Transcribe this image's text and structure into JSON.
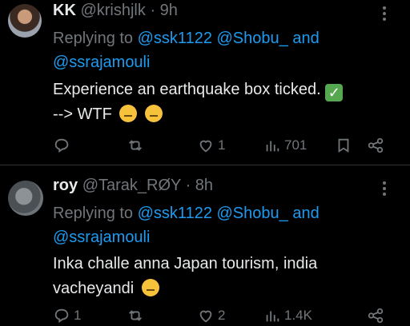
{
  "tweets": [
    {
      "name": "KK",
      "handle": "@krishjlk",
      "sep": "·",
      "time": "9h",
      "replying_label": "Replying to",
      "mentions": [
        "@ssk1122",
        "@Shobu_",
        "@ssrajamouli"
      ],
      "and_word": "and",
      "text_line1": "Experience an earthquake box ticked.",
      "text_line2": "--> WTF",
      "actions": {
        "likes": "1",
        "views": "701"
      }
    },
    {
      "name": "roy",
      "handle": "@Tarak_RØY",
      "sep": "·",
      "time": "8h",
      "replying_label": "Replying to",
      "mentions": [
        "@ssk1122",
        "@Shobu_",
        "@ssrajamouli"
      ],
      "and_word": "and",
      "text_line1": "Inka challe anna Japan tourism, india",
      "text_line2": "vacheyandi",
      "actions": {
        "replies": "1",
        "likes": "2",
        "views": "1.4K"
      }
    }
  ],
  "icons": {
    "reply": "reply-icon",
    "retweet": "retweet-icon",
    "like": "heart-icon",
    "views": "views-icon",
    "bookmark": "bookmark-icon",
    "share": "share-icon",
    "more": "more-icon"
  },
  "colors": {
    "background": "#000000",
    "text": "#e7e9ea",
    "muted": "#71767b",
    "link": "#1d9bf0"
  }
}
